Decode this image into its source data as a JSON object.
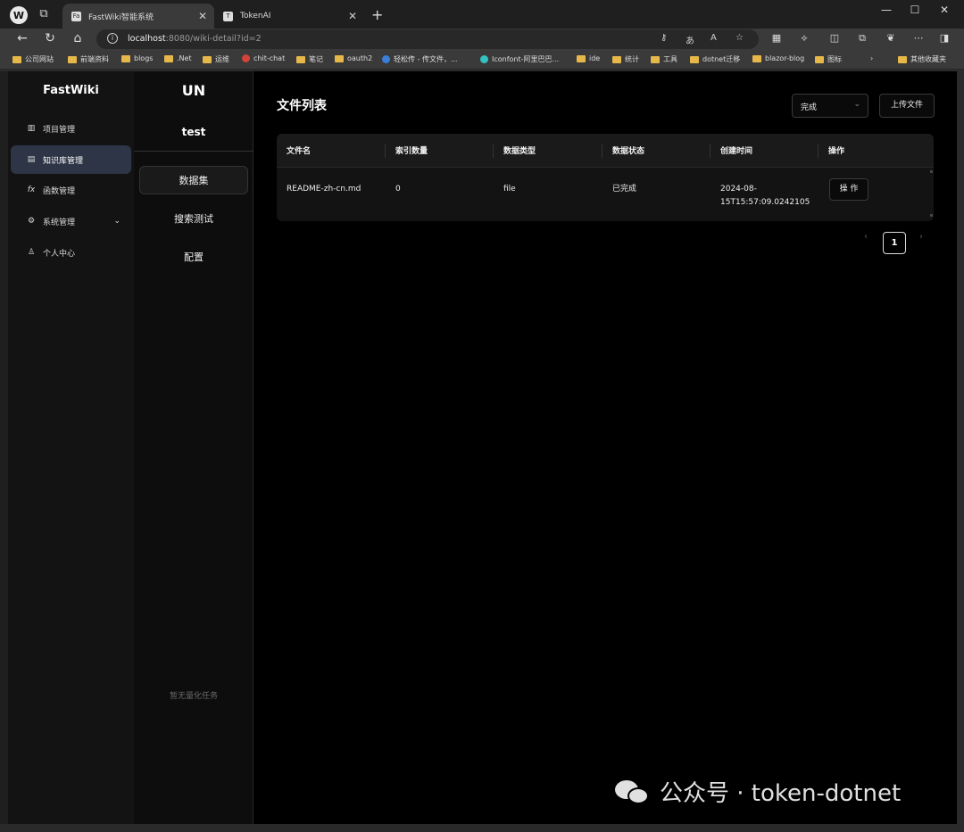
{
  "browser": {
    "logo_text": "W",
    "tabs": [
      {
        "title": "FastWiki智能系统",
        "favicon": "Fa"
      },
      {
        "title": "TokenAI",
        "favicon": "T"
      }
    ],
    "url_host": "localhost",
    "url_path": ":8080/wiki-detail?id=2",
    "window_controls": [
      "—",
      "☐",
      "✕"
    ]
  },
  "bookmarks": [
    {
      "label": "公司网站",
      "type": "folder"
    },
    {
      "label": "前端资料",
      "type": "folder"
    },
    {
      "label": "blogs",
      "type": "folder"
    },
    {
      "label": ".Net",
      "type": "folder"
    },
    {
      "label": "运维",
      "type": "folder"
    },
    {
      "label": "chit-chat",
      "type": "site",
      "color": "#d1443a"
    },
    {
      "label": "笔记",
      "type": "folder"
    },
    {
      "label": "oauth2",
      "type": "folder"
    },
    {
      "label": "轻松传 - 传文件，...",
      "type": "site",
      "color": "#3a7fd9"
    },
    {
      "label": "Iconfont-阿里巴巴...",
      "type": "site",
      "color": "#33c2c2"
    },
    {
      "label": "ide",
      "type": "folder"
    },
    {
      "label": "统计",
      "type": "folder"
    },
    {
      "label": "工具",
      "type": "folder"
    },
    {
      "label": "dotnet迁移",
      "type": "folder"
    },
    {
      "label": "blazor-blog",
      "type": "folder"
    },
    {
      "label": "图标",
      "type": "folder"
    },
    {
      "label": "其他收藏夹",
      "type": "folder"
    }
  ],
  "sidebar": {
    "brand": "FastWiki",
    "items": [
      {
        "label": "项目管理",
        "icon": "▥"
      },
      {
        "label": "知识库管理",
        "icon": "▤"
      },
      {
        "label": "函数管理",
        "icon": "fx"
      },
      {
        "label": "系统管理",
        "icon": "⚙"
      },
      {
        "label": "个人中心",
        "icon": "♙"
      }
    ],
    "expand_arrow": "⌄"
  },
  "panel": {
    "avatar": "UN",
    "name": "test",
    "items": [
      {
        "label": "数据集"
      },
      {
        "label": "搜索测试"
      },
      {
        "label": "配置"
      }
    ],
    "empty_text": "暂无量化任务"
  },
  "main": {
    "title": "文件列表",
    "status_select": "完成",
    "upload_label": "上传文件",
    "columns": [
      "文件名",
      "索引数量",
      "数据类型",
      "数据状态",
      "创建时间",
      "操作"
    ],
    "rows": [
      {
        "name": "README-zh-cn.md",
        "count": "0",
        "type": "file",
        "status": "已完成",
        "created_line1": "2024-08-",
        "created_line2": "15T15:57:09.0242105",
        "action": "操 作"
      }
    ],
    "pager": {
      "prev": "‹",
      "current": "1",
      "next": "›"
    }
  },
  "watermark": {
    "text": "公众号 · token-dotnet"
  }
}
